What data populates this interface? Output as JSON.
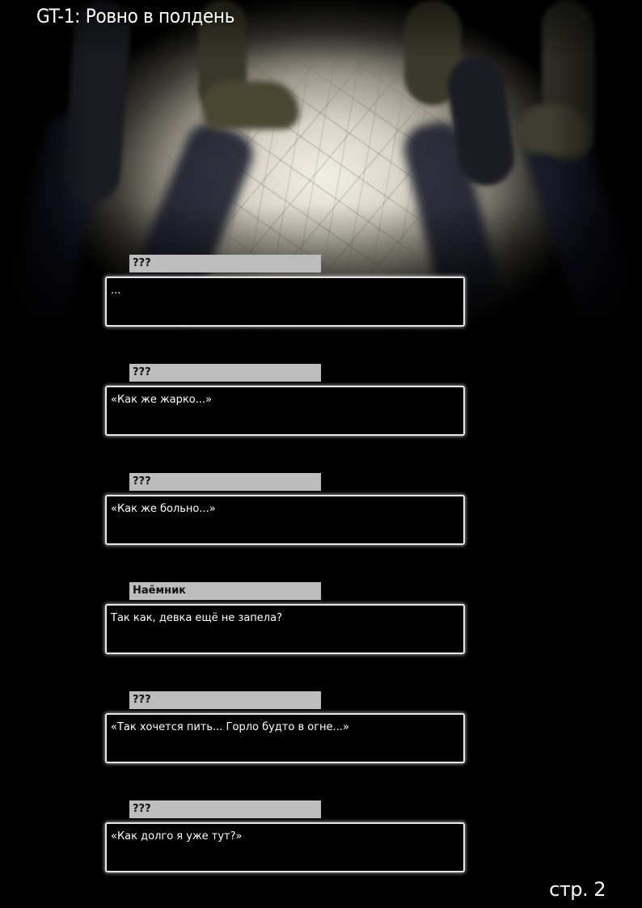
{
  "title": "GT-1: Ровно в полдень",
  "dialogs": [
    {
      "speaker": "???",
      "line": "..."
    },
    {
      "speaker": "???",
      "line": "«Как же жарко...»"
    },
    {
      "speaker": "???",
      "line": "«Как же больно...»"
    },
    {
      "speaker": "Наёмник",
      "line": "Так как, девка ещё не запела?"
    },
    {
      "speaker": "???",
      "line": "«Так хочется пить... Горло будто в огне...»"
    },
    {
      "speaker": "???",
      "line": "«Как долго я уже тут?»"
    }
  ],
  "page_number": "стр. 2",
  "colors": {
    "background": "#000000",
    "speaker_tab": "#bdbdbd",
    "box_border": "#e8e8e8",
    "text": "#ffffff"
  }
}
